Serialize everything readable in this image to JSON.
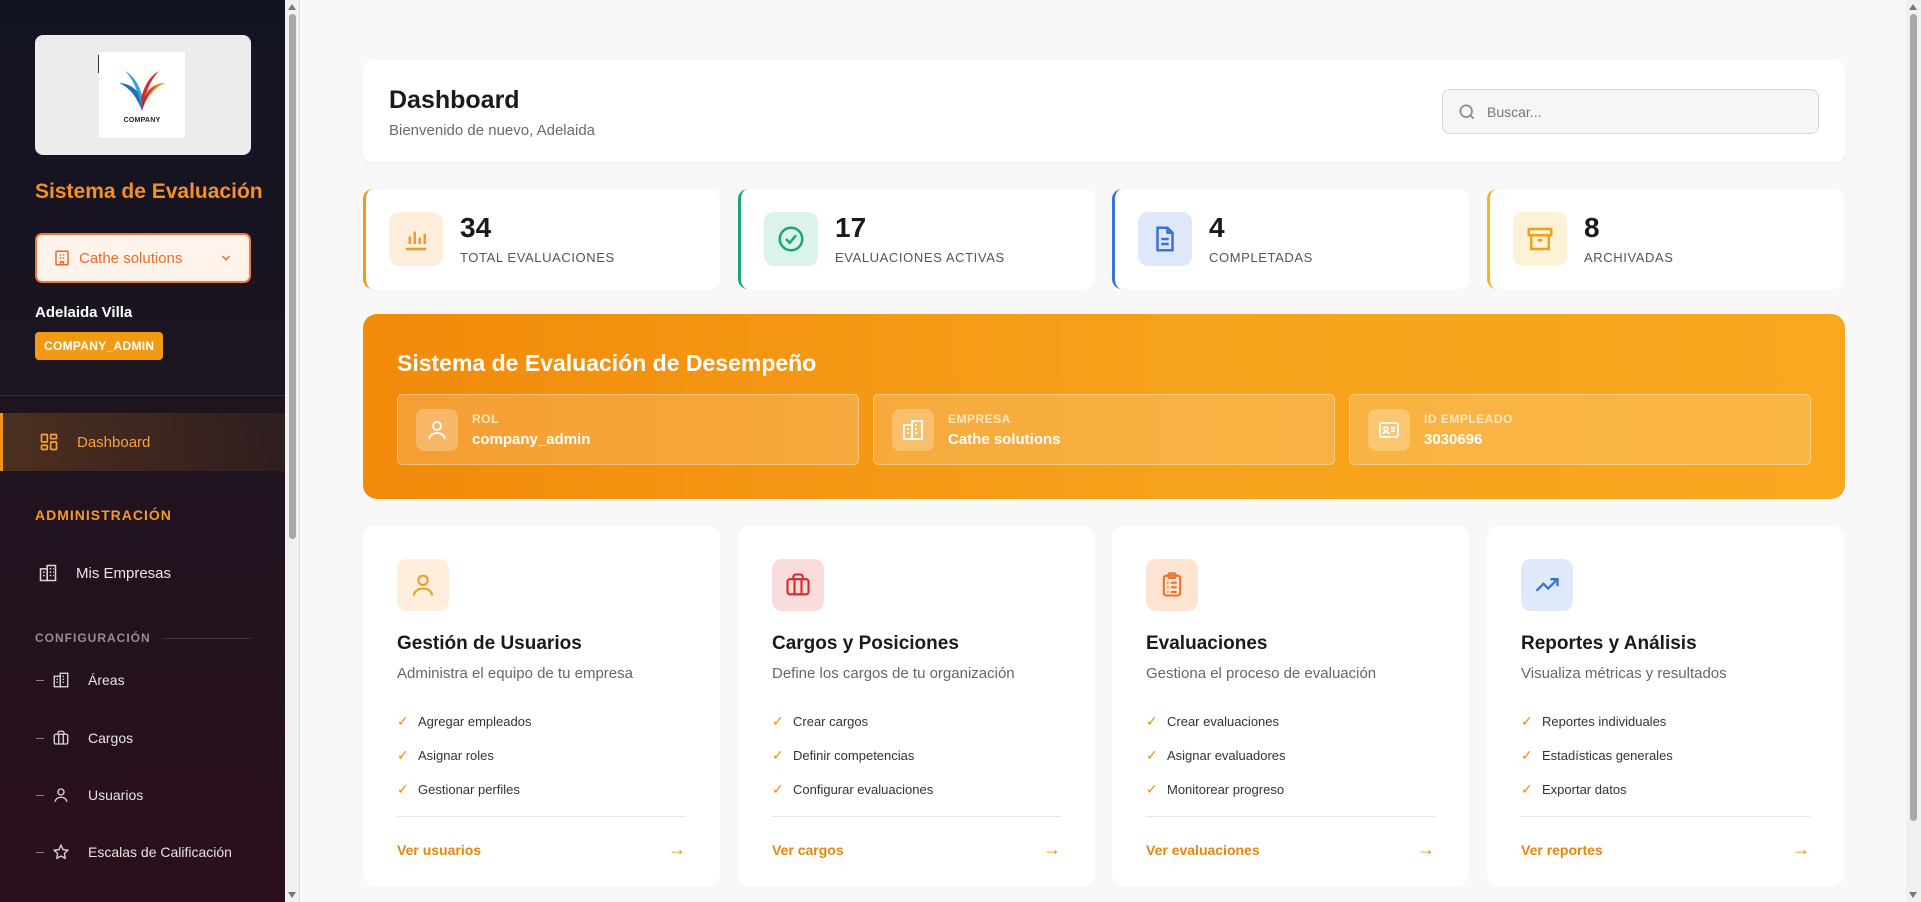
{
  "sidebar": {
    "logo_text": "COMPANY",
    "title": "Sistema de Evaluación",
    "company_selector": "Cathe solutions",
    "user_name": "Adelaida Villa",
    "role": "COMPANY_ADMIN",
    "nav_dashboard": "Dashboard",
    "section_admin": "ADMINISTRACIÓN",
    "nav_empresas": "Mis Empresas",
    "section_config": "CONFIGURACIÓN",
    "config_items": [
      "Áreas",
      "Cargos",
      "Usuarios",
      "Escalas de Calificación"
    ]
  },
  "header": {
    "title": "Dashboard",
    "welcome": "Bienvenido de nuevo, Adelaida",
    "search_placeholder": "Buscar..."
  },
  "stats": [
    {
      "value": "34",
      "label": "TOTAL EVALUACIONES",
      "color": "#f29a13",
      "icon": "bar-chart-icon"
    },
    {
      "value": "17",
      "label": "EVALUACIONES ACTIVAS",
      "color": "#1aa67a",
      "icon": "check-circle-icon"
    },
    {
      "value": "4",
      "label": "COMPLETADAS",
      "color": "#3b72d9",
      "icon": "document-icon"
    },
    {
      "value": "8",
      "label": "ARCHIVADAS",
      "color": "#f2b51d",
      "icon": "archive-icon"
    }
  ],
  "banner": {
    "title": "Sistema de Evaluación de Desempeño",
    "cards": [
      {
        "key": "ROL",
        "value": "company_admin",
        "icon": "user-icon"
      },
      {
        "key": "EMPRESA",
        "value": "Cathe solutions",
        "icon": "building-icon"
      },
      {
        "key": "ID EMPLEADO",
        "value": "3030696",
        "icon": "id-card-icon"
      }
    ]
  },
  "modules": [
    {
      "title": "Gestión de Usuarios",
      "desc": "Administra el equipo de tu empresa",
      "items": [
        "Agregar empleados",
        "Asignar roles",
        "Gestionar perfiles"
      ],
      "link": "Ver usuarios",
      "icon": "user-icon"
    },
    {
      "title": "Cargos y Posiciones",
      "desc": "Define los cargos de tu organización",
      "items": [
        "Crear cargos",
        "Definir competencias",
        "Configurar evaluaciones"
      ],
      "link": "Ver cargos",
      "icon": "briefcase-icon"
    },
    {
      "title": "Evaluaciones",
      "desc": "Gestiona el proceso de evaluación",
      "items": [
        "Crear evaluaciones",
        "Asignar evaluadores",
        "Monitorear progreso"
      ],
      "link": "Ver evaluaciones",
      "icon": "clipboard-icon"
    },
    {
      "title": "Reportes y Análisis",
      "desc": "Visualiza métricas y resultados",
      "items": [
        "Reportes individuales",
        "Estadísticas generales",
        "Exportar datos"
      ],
      "link": "Ver reportes",
      "icon": "trending-up-icon"
    }
  ],
  "colors": {
    "accent": "#f29a13",
    "sidebar_bg": "#1a1420"
  }
}
